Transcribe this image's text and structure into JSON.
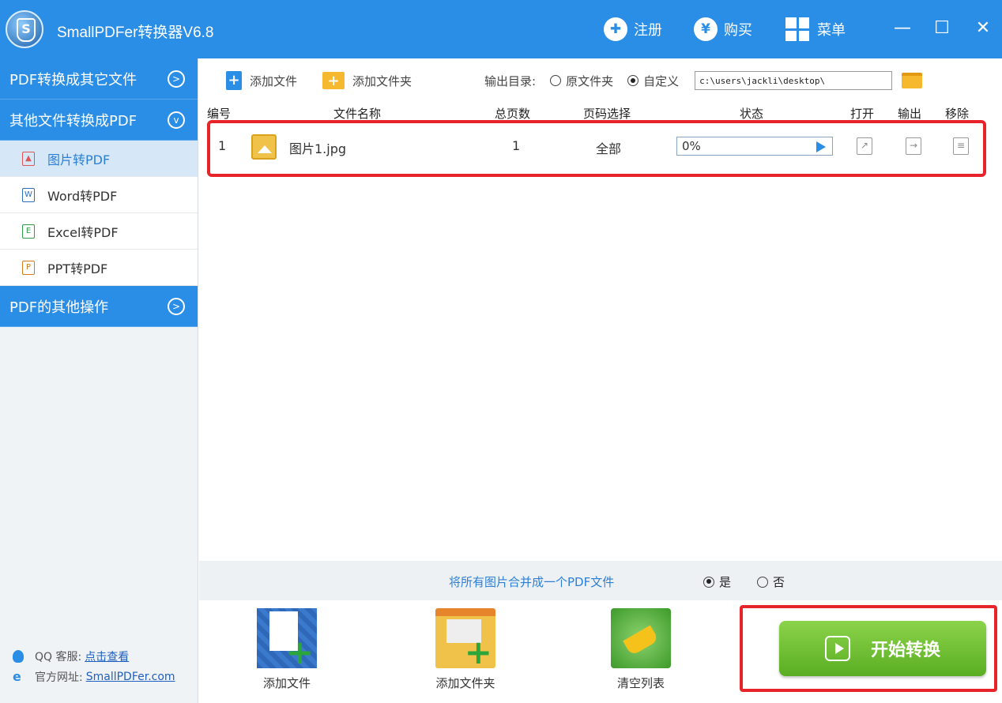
{
  "app": {
    "title": "SmallPDFer转换器V6.8"
  },
  "header": {
    "register": "注册",
    "buy": "购买",
    "menu": "菜单",
    "buy_icon": "¥"
  },
  "sidebar": {
    "section1": "PDF转换成其它文件",
    "section2": "其他文件转换成PDF",
    "items": [
      {
        "label": "图片转PDF",
        "icon": "image-file-icon"
      },
      {
        "label": "Word转PDF",
        "icon": "word-file-icon"
      },
      {
        "label": "Excel转PDF",
        "icon": "excel-file-icon"
      },
      {
        "label": "PPT转PDF",
        "icon": "ppt-file-icon"
      }
    ],
    "section3": "PDF的其他操作",
    "footer": {
      "qq_label": "QQ 客服:",
      "qq_link": "点击查看",
      "site_label": "官方网址:",
      "site_link": "SmallPDFer.com"
    }
  },
  "toolbar": {
    "add_file": "添加文件",
    "add_folder": "添加文件夹",
    "output_label": "输出目录:",
    "radio_source": "原文件夹",
    "radio_custom": "自定义",
    "path": "c:\\users\\jackli\\desktop\\"
  },
  "table": {
    "headers": {
      "no": "编号",
      "name": "文件名称",
      "pages": "总页数",
      "range": "页码选择",
      "status": "状态",
      "open": "打开",
      "output": "输出",
      "remove": "移除"
    },
    "rows": [
      {
        "no": "1",
        "name": "图片1.jpg",
        "pages": "1",
        "range": "全部",
        "status": "0%",
        "progress": 0
      }
    ]
  },
  "merge": {
    "text": "将所有图片合并成一个PDF文件",
    "yes": "是",
    "no": "否",
    "selected": "yes"
  },
  "bottom": {
    "add_file": "添加文件",
    "add_folder": "添加文件夹",
    "clear": "清空列表",
    "start": "开始转换"
  },
  "colors": {
    "accent": "#2b8ee6",
    "start_button": "#6cbf2e",
    "highlight": "#e8242b"
  }
}
